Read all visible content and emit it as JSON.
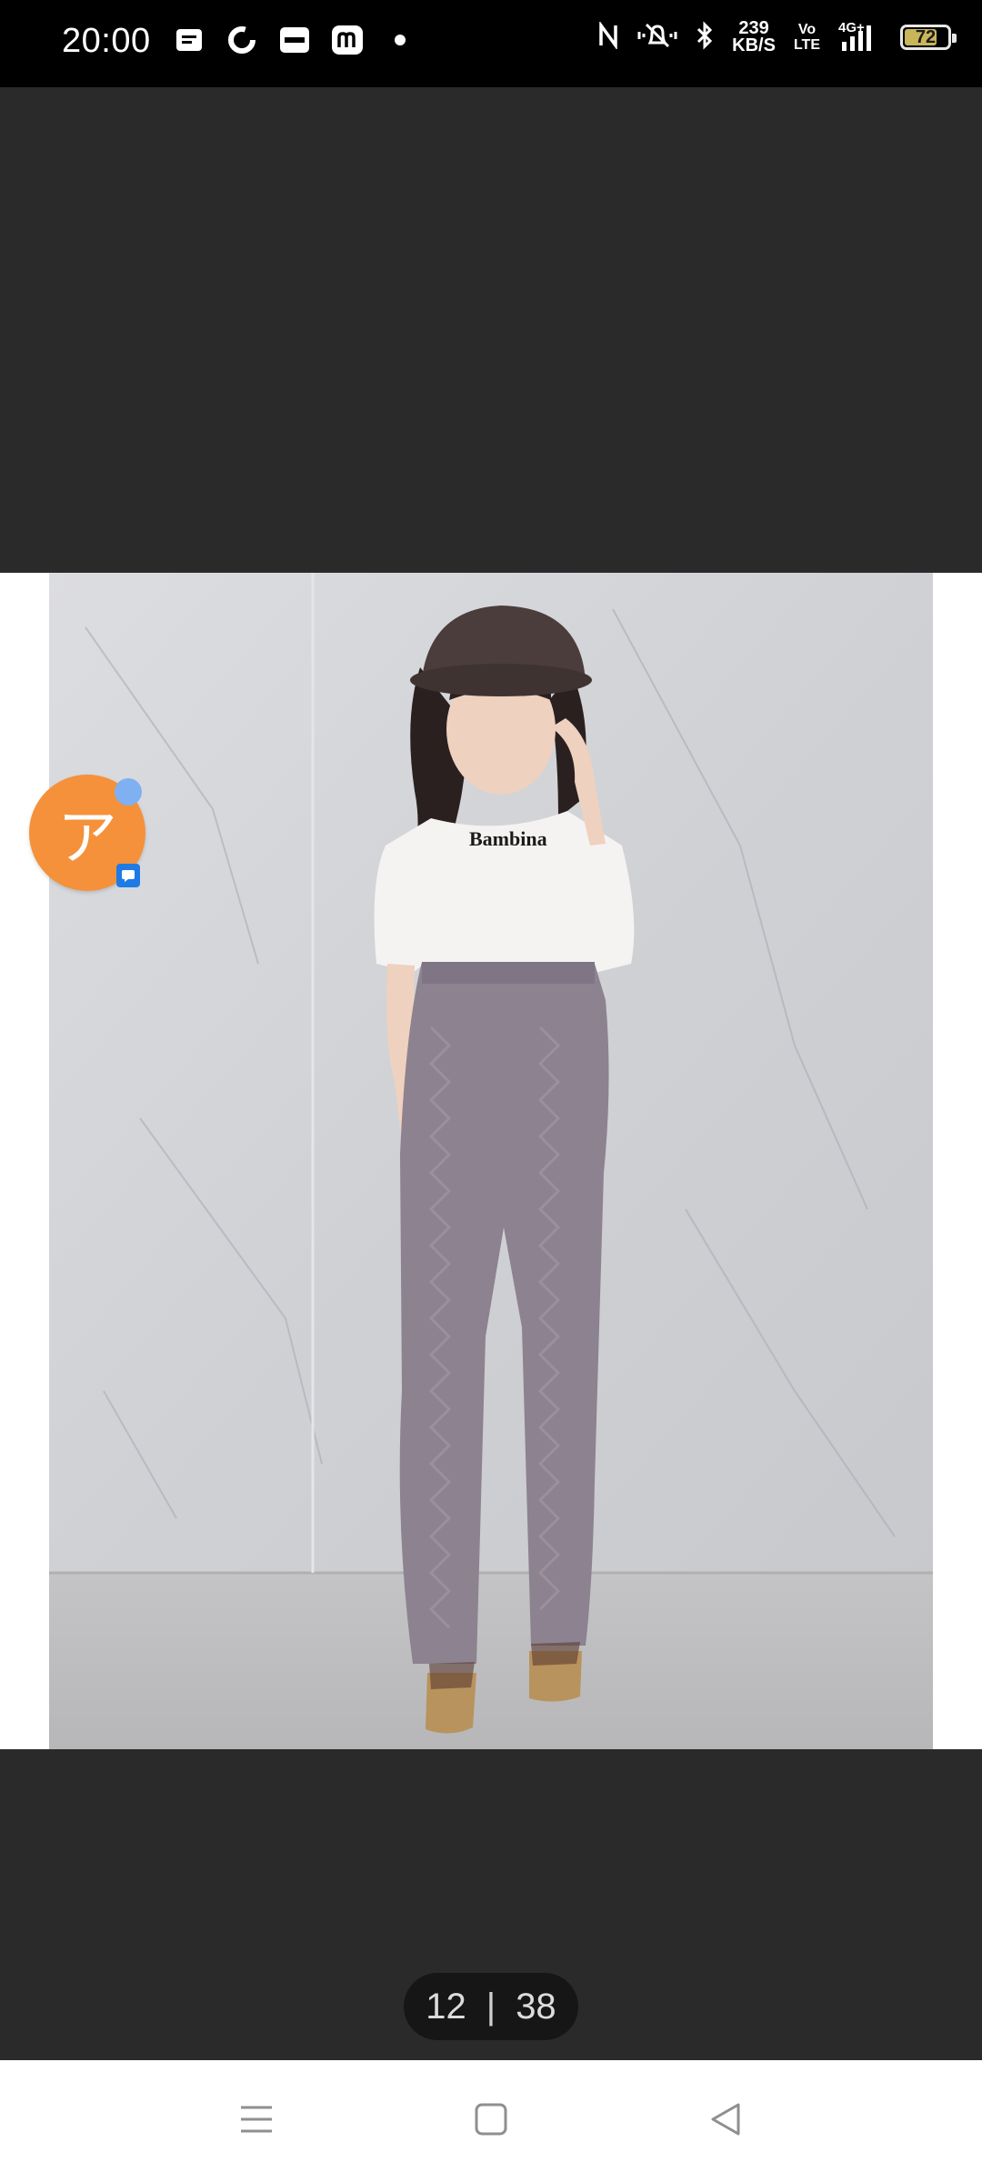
{
  "status_bar": {
    "time": "20:00",
    "speed_value": "239",
    "speed_unit": "KB/S",
    "volte_top": "Vo",
    "volte_bottom": "LTE",
    "network": "4G+",
    "battery": "72"
  },
  "notification_icons": [
    "message-icon",
    "sync-icon",
    "app-badge-icon",
    "m-app-icon",
    "dot-icon"
  ],
  "floating_bubble": {
    "char": "ア"
  },
  "pager": {
    "current": "12",
    "separator": "|",
    "total": "38"
  },
  "nav": {
    "buttons": [
      "menu-icon",
      "home-icon",
      "back-icon"
    ]
  },
  "photo": {
    "tshirt_text": "Bambina"
  },
  "colors": {
    "accent": "#f5913a",
    "badge": "#1e7be6",
    "viewer_bg": "#2a2a2a"
  }
}
